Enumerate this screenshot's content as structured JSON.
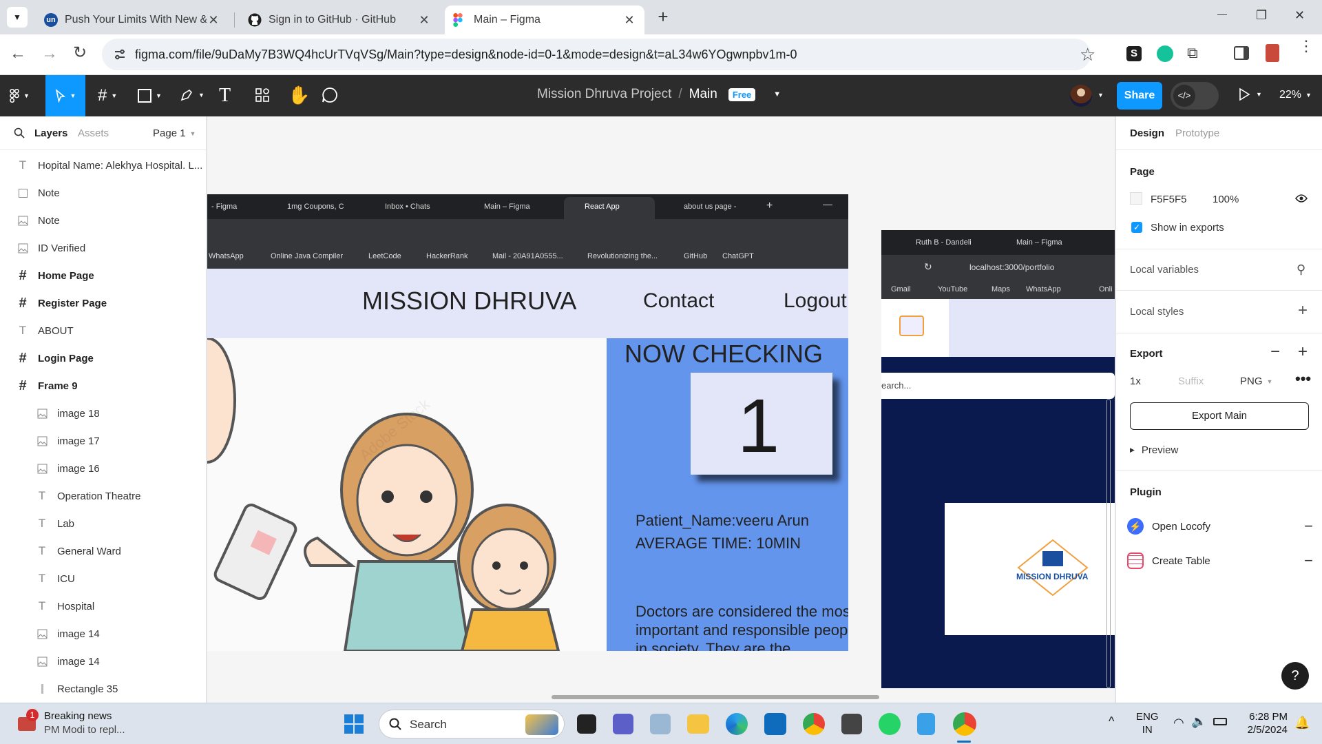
{
  "browser": {
    "tabs": [
      {
        "title": "Push Your Limits With New & U",
        "icon": "unstop-icon"
      },
      {
        "title": "Sign in to GitHub · GitHub",
        "icon": "github-icon"
      },
      {
        "title": "Main – Figma",
        "icon": "figma-icon",
        "active": true
      }
    ],
    "new_tab": "+",
    "url": "figma.com/file/9uDaMy7B3WQ4hcUrTVqVSg/Main?type=design&node-id=0-1&mode=design&t=aL34w6YOgwnpbv1m-0",
    "ext_s": "S",
    "window_controls": [
      "—",
      "❐",
      "✕"
    ]
  },
  "figma": {
    "project": "Mission Dhruva Project",
    "separator": "/",
    "file": "Main",
    "plan_badge": "Free",
    "share": "Share",
    "zoom": "22%",
    "accent": "#0d99ff"
  },
  "left_panel": {
    "tab_layers": "Layers",
    "tab_assets": "Assets",
    "page": "Page 1",
    "layers": [
      {
        "name": "Hopital Name: Alekhya Hospital. L...",
        "type": "text",
        "indent": 0
      },
      {
        "name": "Note",
        "type": "rect",
        "indent": 0
      },
      {
        "name": "Note",
        "type": "image",
        "indent": 0
      },
      {
        "name": "ID Verified",
        "type": "image",
        "indent": 0
      },
      {
        "name": "Home Page",
        "type": "frame",
        "indent": 0
      },
      {
        "name": "Register Page",
        "type": "frame",
        "indent": 0
      },
      {
        "name": "ABOUT",
        "type": "text",
        "indent": 0
      },
      {
        "name": "Login Page",
        "type": "frame",
        "indent": 0
      },
      {
        "name": "Frame 9",
        "type": "frame",
        "indent": 0
      },
      {
        "name": "image 18",
        "type": "image",
        "indent": 1
      },
      {
        "name": "image 17",
        "type": "image",
        "indent": 1
      },
      {
        "name": "image 16",
        "type": "image",
        "indent": 1
      },
      {
        "name": "Operation Theatre",
        "type": "text",
        "indent": 1
      },
      {
        "name": "Lab",
        "type": "text",
        "indent": 1
      },
      {
        "name": "General Ward",
        "type": "text",
        "indent": 1
      },
      {
        "name": "ICU",
        "type": "text",
        "indent": 1
      },
      {
        "name": "Hospital",
        "type": "text",
        "indent": 1
      },
      {
        "name": "image 14",
        "type": "image",
        "indent": 1
      },
      {
        "name": "image 14",
        "type": "image",
        "indent": 1
      },
      {
        "name": "Rectangle 35",
        "type": "line",
        "indent": 1
      }
    ]
  },
  "canvas": {
    "shot1": {
      "tabs": [
        "- Figma",
        "1mg Coupons, C",
        "Inbox • Chats",
        "Main – Figma",
        "React App",
        "about us page -"
      ],
      "bookmarks": [
        "WhatsApp",
        "Online Java Compiler",
        "LeetCode",
        "HackerRank",
        "Mail - 20A91A0555...",
        "Revolutionizing the...",
        "GitHub",
        "ChatGPT"
      ],
      "brand": "MISSION DHRUVA",
      "nav_contact": "Contact",
      "nav_logout": "Logout",
      "now_checking": "NOW CHECKING",
      "token": "1",
      "patient": "Patient_Name:veeru Arun",
      "avg_time": "AVERAGE TIME: 10MIN",
      "doctors_text": "Doctors are considered the most important and responsible people in society. They are the",
      "watermark": "Adobe Stock"
    },
    "shot2": {
      "tabs": [
        "Ruth B - Dandeli",
        "Main – Figma"
      ],
      "url": "localhost:3000/portfolio",
      "bookmarks": [
        "Gmail",
        "YouTube",
        "Maps",
        "WhatsApp",
        "Onli"
      ],
      "search_placeholder": "earch...",
      "logo_text": "MISSION DHRUVA"
    }
  },
  "right_panel": {
    "tab_design": "Design",
    "tab_prototype": "Prototype",
    "page_label": "Page",
    "page_color": "F5F5F5",
    "page_opacity": "100%",
    "show_in_exports": "Show in exports",
    "local_variables": "Local variables",
    "local_styles": "Local styles",
    "export_label": "Export",
    "export_scale": "1x",
    "export_suffix": "Suffix",
    "export_format": "PNG",
    "export_button": "Export Main",
    "preview": "Preview",
    "plugin_label": "Plugin",
    "plugins": [
      "Open Locofy",
      "Create Table"
    ],
    "help": "?"
  },
  "taskbar": {
    "news_title": "Breaking news",
    "news_sub": "PM Modi to repl...",
    "news_badge": "1",
    "search": "Search",
    "lang1": "ENG",
    "lang2": "IN",
    "time": "6:28 PM",
    "date": "2/5/2024"
  }
}
